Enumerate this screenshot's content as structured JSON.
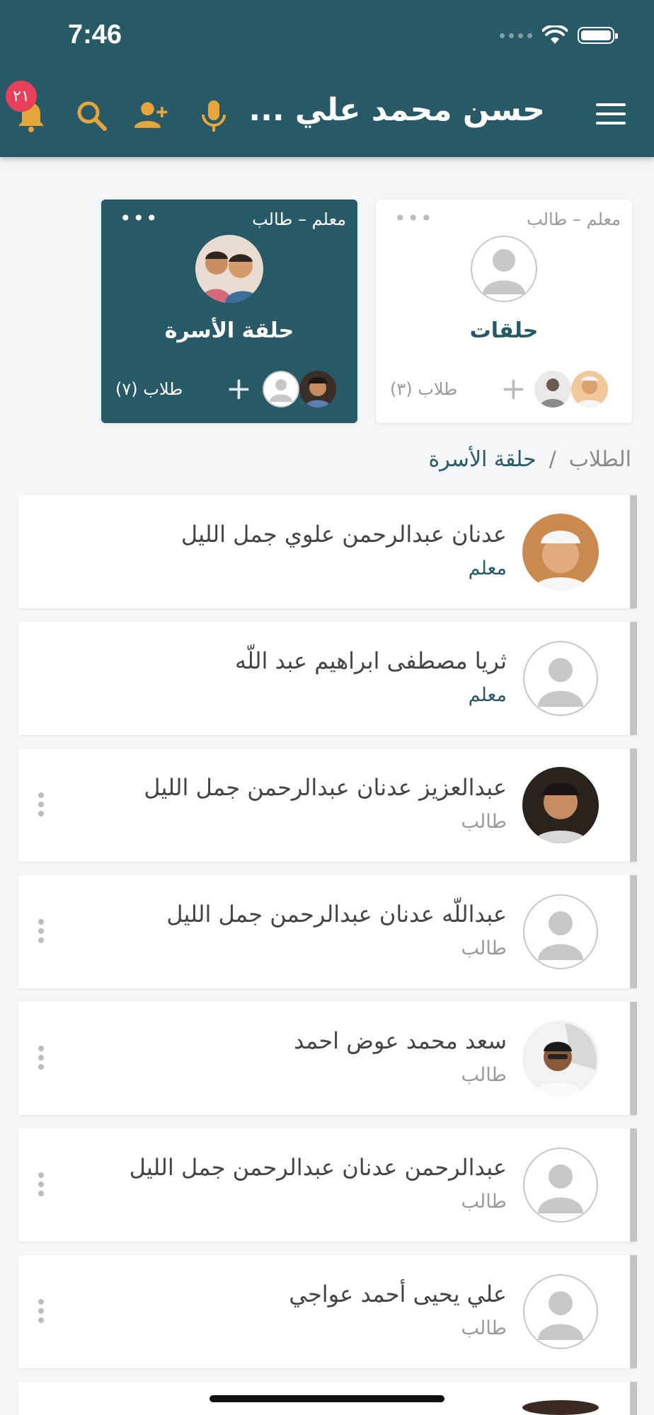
{
  "status_bar": {
    "time": "7:46"
  },
  "header": {
    "title": "حسن محمد علي ...",
    "notification_count": "٢١",
    "colors": {
      "bar": "#275a66",
      "icons": "#e6a63b"
    },
    "icons": [
      "menu-icon",
      "microphone-icon",
      "add-user-icon",
      "search-icon",
      "bell-icon"
    ]
  },
  "cards": [
    {
      "role": "معلم – طالب",
      "name": "حلقات",
      "count": "طلاب (٣)",
      "theme": "light"
    },
    {
      "role": "معلم – طالب",
      "name": "حلقة الأسرة",
      "count": "طلاب (٧)",
      "theme": "dark"
    }
  ],
  "breadcrumb": {
    "root": "الطلاب",
    "separator": "/",
    "current": "حلقة الأسرة"
  },
  "members": [
    {
      "name": "عدنان عبدالرحمن علوي جمل الليل",
      "role": "معلم",
      "type": "teacher",
      "avatar": "photo-man-cap"
    },
    {
      "name": "ثريا مصطفى ابراهيم عبد اللّه",
      "role": "معلم",
      "type": "teacher",
      "avatar": "placeholder"
    },
    {
      "name": "عبدالعزيز عدنان عبدالرحمن جمل الليل",
      "role": "طالب",
      "type": "student",
      "avatar": "photo-boy"
    },
    {
      "name": "عبداللّه عدنان عبدالرحمن جمل الليل",
      "role": "طالب",
      "type": "student",
      "avatar": "placeholder"
    },
    {
      "name": "سعد محمد عوض احمد",
      "role": "طالب",
      "type": "student",
      "avatar": "photo-man-glasses"
    },
    {
      "name": "عبدالرحمن عدنان عبدالرحمن جمل الليل",
      "role": "طالب",
      "type": "student",
      "avatar": "placeholder"
    },
    {
      "name": "علي يحيى أحمد عواجي",
      "role": "طالب",
      "type": "student",
      "avatar": "placeholder"
    }
  ]
}
